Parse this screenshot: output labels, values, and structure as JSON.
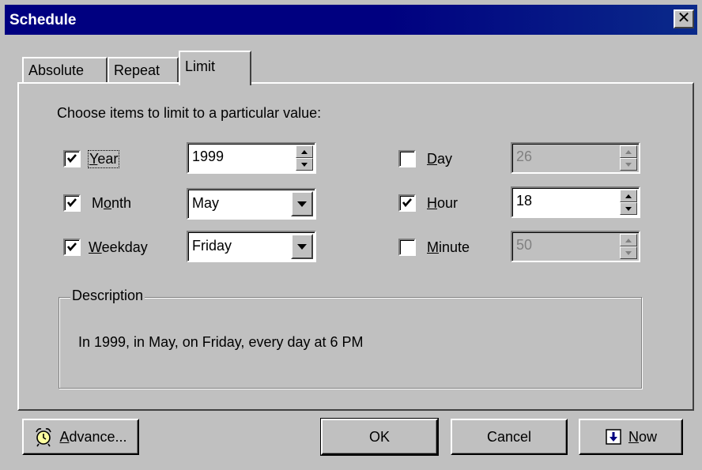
{
  "window": {
    "title": "Schedule",
    "close_glyph": "✕"
  },
  "tabs": [
    {
      "label": "Absolute",
      "active": false
    },
    {
      "label": "Repeat",
      "active": false
    },
    {
      "label": "Limit",
      "active": true
    }
  ],
  "instruction": "Choose items to limit to a particular value:",
  "fields": {
    "year": {
      "pre": "",
      "accel": "Y",
      "post": "ear",
      "checked": true,
      "value": "1999",
      "kind": "spin",
      "enabled": true
    },
    "month": {
      "pre": "M",
      "accel": "o",
      "post": "nth",
      "checked": true,
      "value": "May",
      "kind": "combo",
      "enabled": true
    },
    "weekday": {
      "pre": "",
      "accel": "W",
      "post": "eekday",
      "checked": true,
      "value": "Friday",
      "kind": "combo",
      "enabled": true
    },
    "day": {
      "pre": "",
      "accel": "D",
      "post": "ay",
      "checked": false,
      "value": "26",
      "kind": "spin",
      "enabled": false
    },
    "hour": {
      "pre": "",
      "accel": "H",
      "post": "our",
      "checked": true,
      "value": "18",
      "kind": "spin",
      "enabled": true
    },
    "minute": {
      "pre": "",
      "accel": "M",
      "post": "inute",
      "checked": false,
      "value": "50",
      "kind": "spin",
      "enabled": false
    }
  },
  "description": {
    "title": "Description",
    "text": "In 1999, in May, on Friday, every day at 6 PM"
  },
  "buttons": {
    "advance": {
      "accel": "A",
      "rest": "dvance...",
      "icon": "alarm-clock-icon"
    },
    "ok": {
      "label": "OK"
    },
    "cancel": {
      "label": "Cancel"
    },
    "now": {
      "accel": "N",
      "rest": "ow",
      "icon": "download-arrow-icon"
    }
  },
  "colors": {
    "titlebar": "#000080",
    "face": "#c0c0c0",
    "disabled_text": "#808080"
  }
}
